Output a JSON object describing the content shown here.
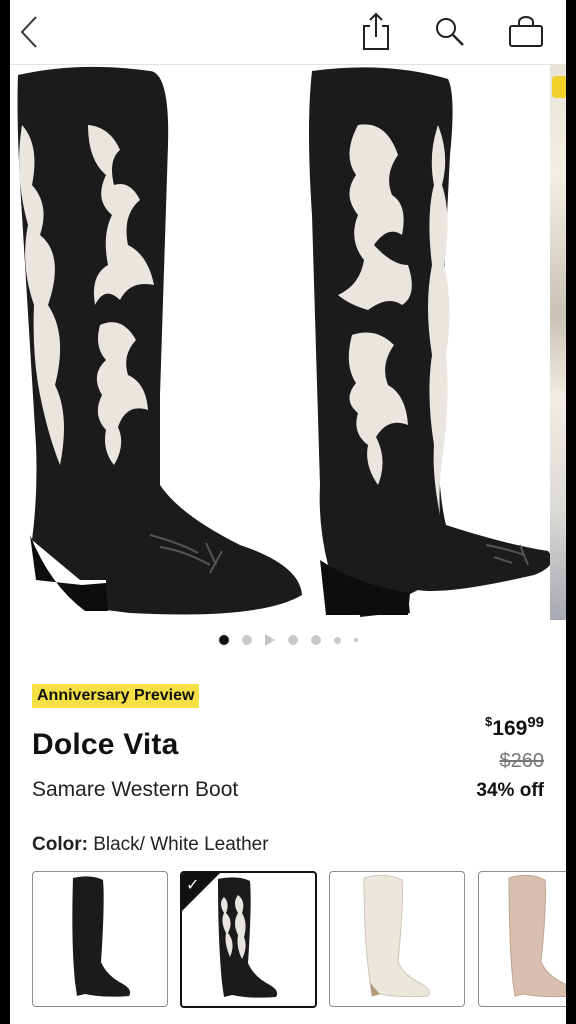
{
  "header": {
    "back_icon": "chevron-left-icon",
    "share_icon": "share-icon",
    "search_icon": "search-icon",
    "bag_icon": "shopping-bag-icon"
  },
  "gallery": {
    "image_count": 7,
    "active_index": 0
  },
  "product": {
    "badge": "Anniversary Preview",
    "brand": "Dolce Vita",
    "name": "Samare Western Boot",
    "price_dollar_sign": "$",
    "price_whole": "169",
    "price_cents": "99",
    "original_price": "$260",
    "discount": "34% off"
  },
  "color": {
    "label": "Color:",
    "value": "Black/ White Leather",
    "options": [
      "black",
      "black-white",
      "white",
      "blush"
    ],
    "selected_index": 1
  },
  "colors": {
    "badge_bg": "#f4e043",
    "text": "#111111",
    "muted": "#777777"
  }
}
